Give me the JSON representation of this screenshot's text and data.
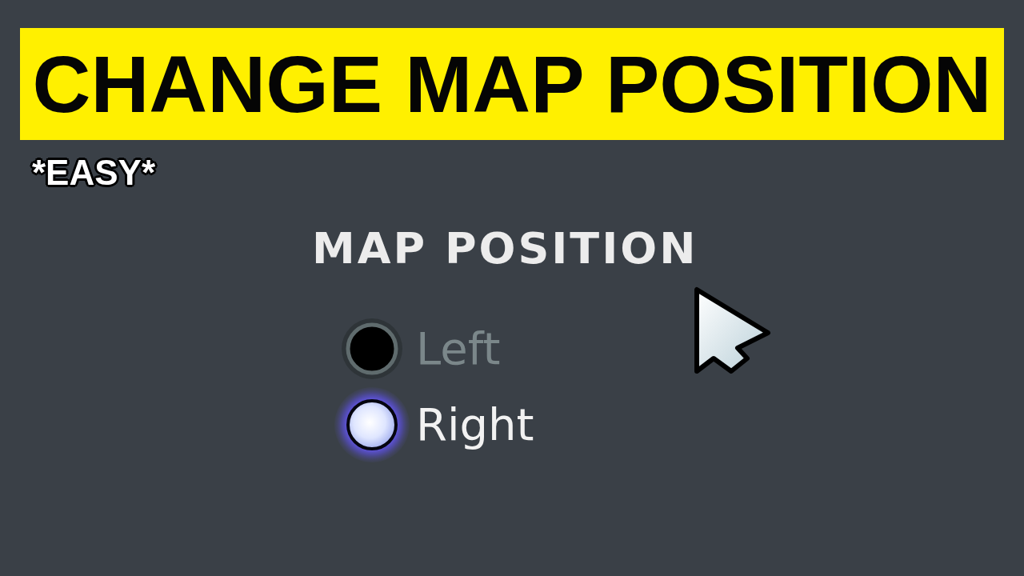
{
  "banner": {
    "title": "CHANGE MAP POSITION"
  },
  "tag": "*EASY*",
  "settings": {
    "heading": "MAP POSITION",
    "options": [
      {
        "label": "Left",
        "selected": false
      },
      {
        "label": "Right",
        "selected": true
      }
    ]
  }
}
